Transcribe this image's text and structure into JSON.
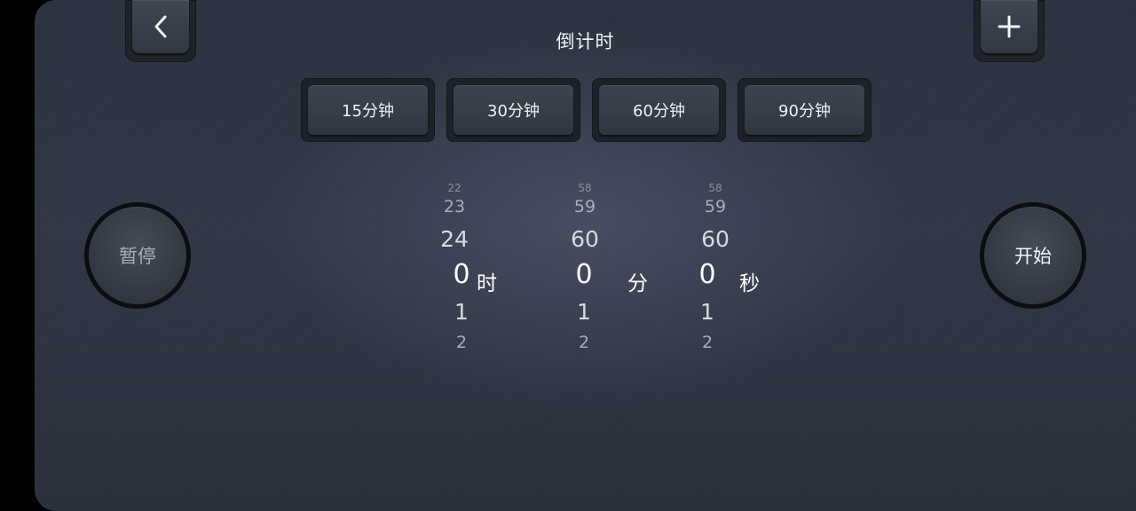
{
  "header": {
    "title": "倒计时"
  },
  "icons": {
    "back": "chevron-left-icon",
    "add": "plus-icon"
  },
  "presets": [
    {
      "label": "15分钟"
    },
    {
      "label": "30分钟"
    },
    {
      "label": "60分钟"
    },
    {
      "label": "90分钟"
    }
  ],
  "controls": {
    "pause_label": "暂停",
    "start_label": "开始"
  },
  "picker": {
    "hours": {
      "rows": [
        "22",
        "23",
        "24",
        "0",
        "1",
        "2"
      ],
      "unit": "时"
    },
    "minutes": {
      "rows": [
        "58",
        "59",
        "60",
        "0",
        "1",
        "2"
      ],
      "unit": "分"
    },
    "seconds": {
      "rows": [
        "58",
        "59",
        "60",
        "0",
        "1",
        "2"
      ],
      "unit": "秒"
    }
  },
  "colors": {
    "background": "#2e3441",
    "text": "#f2f4f6",
    "dim_text": "#a9aeb6"
  }
}
